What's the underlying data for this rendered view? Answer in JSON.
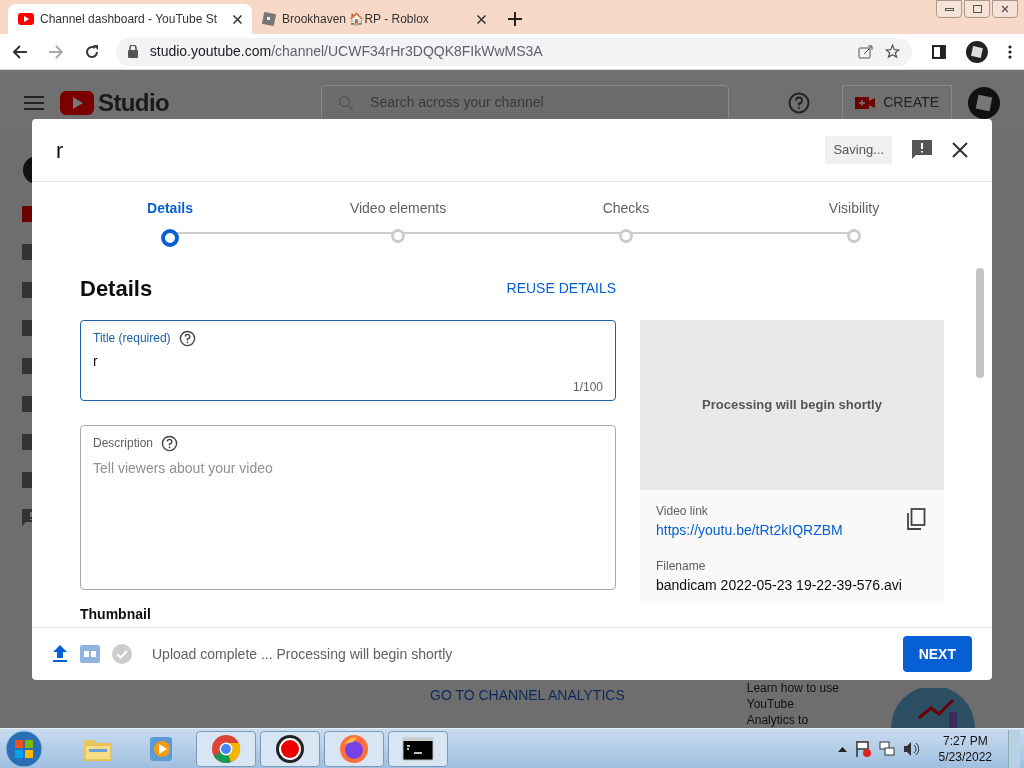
{
  "browser": {
    "tabs": [
      {
        "title": "Channel dashboard - YouTube St",
        "selected": true
      },
      {
        "title": "Brookhaven 🏠RP - Roblox",
        "selected": false
      }
    ],
    "address": {
      "host": "studio.youtube.com",
      "path": "/channel/UCWF34rHr3DQQK8FIkWwMS3A"
    }
  },
  "studio": {
    "logo": "Studio",
    "search": {
      "placeholder": "Search across your channel"
    },
    "create": "CREATE",
    "analytics_link": "GO TO CHANNEL ANALYTICS",
    "tip_lines": [
      "Learn how to use",
      "YouTube",
      "Analytics to"
    ]
  },
  "dialog": {
    "title": "r",
    "saving": "Saving...",
    "steps": [
      {
        "label": "Details",
        "selected": true
      },
      {
        "label": "Video elements",
        "selected": false
      },
      {
        "label": "Checks",
        "selected": false
      },
      {
        "label": "Visibility",
        "selected": false
      }
    ],
    "heading": "Details",
    "reuse": "REUSE DETAILS",
    "title_field": {
      "label": "Title (required)",
      "value": "r",
      "count": "1/100"
    },
    "description_field": {
      "label": "Description",
      "placeholder": "Tell viewers about your video"
    },
    "thumbnail_heading": "Thumbnail",
    "preview": {
      "message": "Processing will begin shortly",
      "link_label": "Video link",
      "link": "https://youtu.be/tRt2kIQRZBM",
      "filename_label": "Filename",
      "filename": "bandicam 2022-05-23 19-22-39-576.avi"
    },
    "footer": {
      "status": "Upload complete ... Processing will begin shortly",
      "next": "NEXT"
    }
  },
  "taskbar": {
    "apps": [
      {
        "kind": "folder",
        "selected": false
      },
      {
        "kind": "media",
        "selected": false
      },
      {
        "kind": "chrome",
        "selected": true
      },
      {
        "kind": "record",
        "selected": true
      },
      {
        "kind": "firefox",
        "selected": true
      },
      {
        "kind": "console",
        "selected": true
      }
    ],
    "time": "7:27 PM",
    "date": "5/23/2022"
  }
}
